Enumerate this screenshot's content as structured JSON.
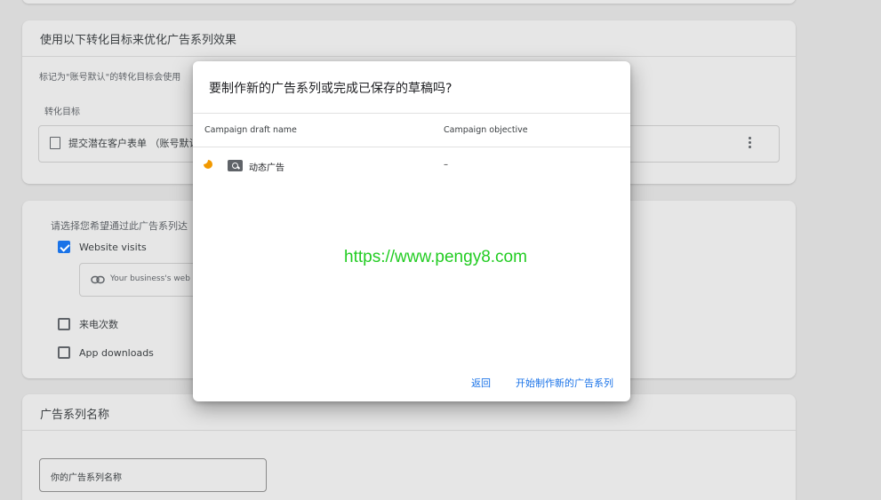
{
  "background": {
    "goals_card": {
      "title": "使用以下转化目标来优化广告系列效果",
      "note": "标记为\"账号默认\"的转化目标会使用",
      "column_header": "转化目标",
      "goal_label": "提交潜在客户表单  （账号默认"
    },
    "reach_card": {
      "prompt": "请选择您希望通过此广告系列达",
      "options": [
        {
          "label": "Website visits",
          "checked": true
        },
        {
          "label": "来电次数",
          "checked": false
        },
        {
          "label": "App downloads",
          "checked": false
        }
      ],
      "url_placeholder": "Your business's web"
    },
    "name_card": {
      "title": "广告系列名称",
      "input_placeholder": "你的广告系列名称"
    }
  },
  "dialog": {
    "title": "要制作新的广告系列或完成已保存的草稿吗?",
    "columns": {
      "draft_name": "Campaign draft name",
      "objective": "Campaign objective"
    },
    "drafts": [
      {
        "name": "动态广告",
        "objective": "–",
        "status_icon": "draft-status-icon",
        "type_icon": "search-campaign-icon"
      }
    ],
    "buttons": {
      "back": "返回",
      "new_campaign": "开始制作新的广告系列"
    },
    "watermark": "https://www.pengy8.com"
  },
  "colors": {
    "accent": "#1a73e8",
    "draft_status": "#f29900",
    "watermark": "#22cc22"
  }
}
